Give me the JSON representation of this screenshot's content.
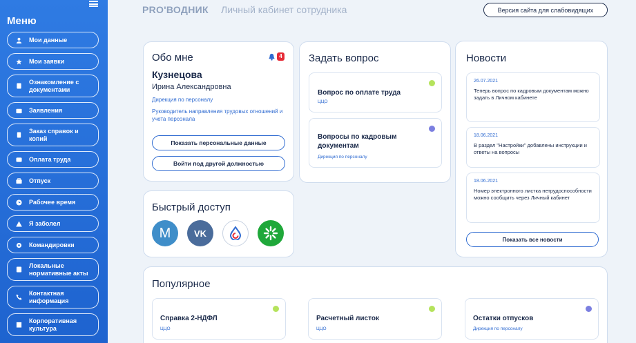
{
  "sidebar": {
    "title": "Меню",
    "items": [
      {
        "label": "Мои данные",
        "icon": "person-icon"
      },
      {
        "label": "Мои заявки",
        "icon": "star-icon"
      },
      {
        "label": "Ознакомление с документами",
        "icon": "document-icon"
      },
      {
        "label": "Заявления",
        "icon": "folder-icon"
      },
      {
        "label": "Заказ справок и копий",
        "icon": "copy-icon"
      },
      {
        "label": "Оплата труда",
        "icon": "wallet-icon"
      },
      {
        "label": "Отпуск",
        "icon": "suitcase-icon"
      },
      {
        "label": "Рабочее время",
        "icon": "clock-icon"
      },
      {
        "label": "Я заболел",
        "icon": "warning-icon"
      },
      {
        "label": "Командировки",
        "icon": "gear-icon"
      },
      {
        "label": "Локальные нормативные акты",
        "icon": "book-icon"
      },
      {
        "label": "Контактная информация",
        "icon": "phone-icon"
      },
      {
        "label": "Корпоративная культура",
        "icon": "building-icon"
      }
    ]
  },
  "header": {
    "brand": "PRO'ВОДНИК",
    "subtitle": "Личный кабинет сотрудника",
    "accessible_button": "Версия сайта для слабовидящих"
  },
  "about": {
    "title": "Обо мне",
    "notification_count": "4",
    "surname": "Кузнецова",
    "name": "Ирина Александровна",
    "department": "Дирекция по персоналу",
    "position": "Руководитель направления трудовых отношений и учета персонала",
    "show_data_button": "Показать персональные данные",
    "switch_position_button": "Войти под другой должностью"
  },
  "ask": {
    "title": "Задать вопрос",
    "questions": [
      {
        "title": "Вопрос по оплате труда",
        "sub": "ЦЦО",
        "dot_color": "#b5e35c"
      },
      {
        "title": "Вопросы по кадровым документам",
        "sub": "Дирекция по персоналу",
        "dot_color": "#7b7fe0"
      }
    ]
  },
  "news": {
    "title": "Новости",
    "items": [
      {
        "date": "26.07.2021",
        "text": "Теперь вопрос по кадровым документам можно задать в Личном кабинете"
      },
      {
        "date": "18.06.2021",
        "text": "В раздел \"Настройки\" добавлены инструкции и ответы на вопросы"
      },
      {
        "date": "18.06.2021",
        "text": "Номер электронного листка нетрудоспособности можно сообщить через Личный кабинет"
      }
    ],
    "show_all_button": "Показать все новости"
  },
  "quick": {
    "title": "Быстрый доступ",
    "links": [
      {
        "icon": "m-icon",
        "label": "M",
        "color": "#3f8ec9"
      },
      {
        "icon": "vk-icon",
        "label": "VK",
        "color": "#4a6c9b"
      },
      {
        "icon": "drop-icon",
        "label": "",
        "color": "#ffffff"
      },
      {
        "icon": "sber-icon",
        "label": "",
        "color": "#1fa83a"
      }
    ]
  },
  "popular": {
    "title": "Популярное",
    "items": [
      {
        "title": "Справка 2-НДФЛ",
        "sub": "ЦЦО",
        "dot_color": "#b5e35c"
      },
      {
        "title": "Расчетный листок",
        "sub": "ЦЦО",
        "dot_color": "#b5e35c"
      },
      {
        "title": "Остатки отпусков",
        "sub": "Дирекция по персоналу",
        "dot_color": "#7b7fe0"
      }
    ]
  }
}
